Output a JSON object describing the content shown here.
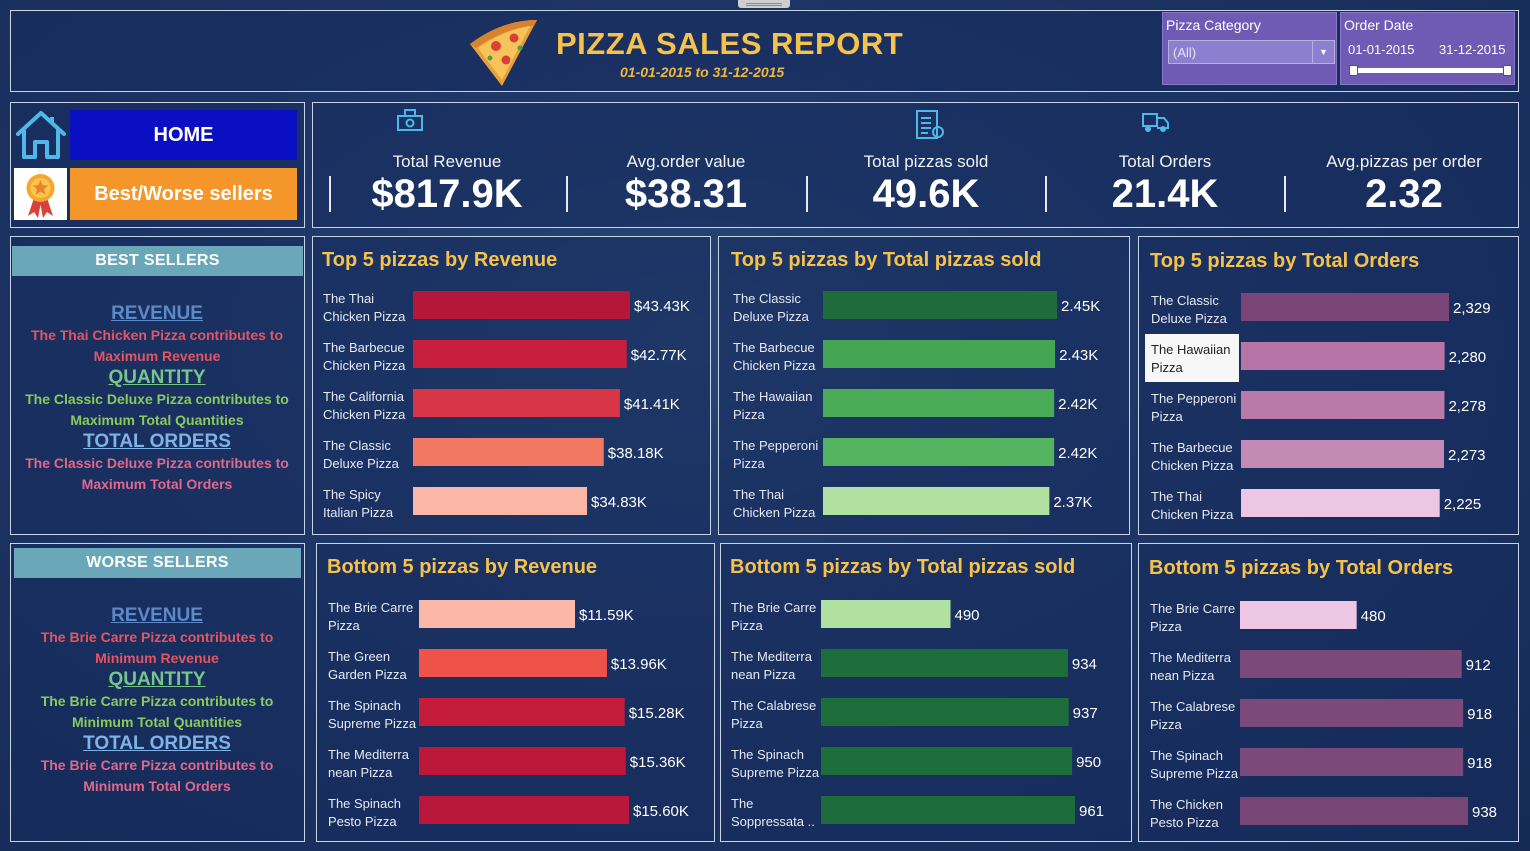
{
  "header": {
    "title": "PIZZA SALES REPORT",
    "subtitle": "01-01-2015 to 31-12-2015",
    "filters": {
      "category_label": "Pizza Category",
      "category_value": "(All)",
      "date_label": "Order Date",
      "date_start": "01-01-2015",
      "date_end": "31-12-2015"
    }
  },
  "nav": {
    "home": "HOME",
    "best_worse": "Best/Worse sellers"
  },
  "kpis": [
    {
      "label": "Total Revenue",
      "value": "$817.9K",
      "icon": "money-icon"
    },
    {
      "label": "Avg.order value",
      "value": "$38.31",
      "icon": ""
    },
    {
      "label": "Total pizzas sold",
      "value": "49.6K",
      "icon": "checklist-icon"
    },
    {
      "label": "Total Orders",
      "value": "21.4K",
      "icon": "delivery-icon"
    },
    {
      "label": "Avg.pizzas per order",
      "value": "2.32",
      "icon": ""
    }
  ],
  "best": {
    "title": "BEST SELLERS",
    "rev_head": "REVENUE",
    "rev_l1": "The Thai Chicken Pizza contributes to",
    "rev_l2": "Maximum Revenue",
    "qty_head": "QUANTITY",
    "qty_l1": "The Classic Deluxe Pizza contributes to",
    "qty_l2": "Maximum Total Quantities",
    "ord_head": "TOTAL ORDERS",
    "ord_l1": "The Classic Deluxe Pizza contributes to",
    "ord_l2": "Maximum Total Orders"
  },
  "worse": {
    "title": "WORSE SELLERS",
    "rev_head": "REVENUE",
    "rev_l1": "The Brie Carre Pizza contributes to",
    "rev_l2": "Minimum Revenue",
    "qty_head": "QUANTITY",
    "qty_l1": "The Brie Carre Pizza contributes to",
    "qty_l2": "Minimum Total Quantities",
    "ord_head": "TOTAL ORDERS",
    "ord_l1": "The Brie Carre Pizza  contributes to",
    "ord_l2": "Minimum Total Orders"
  },
  "chart_data": [
    {
      "id": "top-revenue",
      "type": "bar",
      "orientation": "horizontal",
      "title": "Top 5 pizzas by Revenue",
      "categories": [
        [
          "The Thai",
          "Chicken Pizza"
        ],
        [
          "The Barbecue",
          "Chicken Pizza"
        ],
        [
          "The California",
          "Chicken Pizza"
        ],
        [
          "The Classic",
          "Deluxe Pizza"
        ],
        [
          "The Spicy",
          "Italian Pizza"
        ]
      ],
      "values": [
        43430,
        42770,
        41410,
        38180,
        34830
      ],
      "labels": [
        "$43.43K",
        "$42.77K",
        "$41.41K",
        "$38.18K",
        "$34.83K"
      ],
      "colors": [
        "#b5173a",
        "#c91f3e",
        "#d93548",
        "#f27864",
        "#fbb7a5"
      ]
    },
    {
      "id": "top-qty",
      "type": "bar",
      "orientation": "horizontal",
      "title": "Top 5 pizzas by Total pizzas sold",
      "categories": [
        [
          "The Classic",
          "Deluxe Pizza"
        ],
        [
          "The Barbecue",
          "Chicken Pizza"
        ],
        [
          "The Hawaiian",
          "Pizza"
        ],
        [
          "The Pepperoni",
          "Pizza"
        ],
        [
          "The Thai",
          "Chicken Pizza"
        ]
      ],
      "values": [
        2450,
        2430,
        2420,
        2420,
        2370
      ],
      "labels": [
        "2.45K",
        "2.43K",
        "2.42K",
        "2.42K",
        "2.37K"
      ],
      "colors": [
        "#1f6b3a",
        "#44a653",
        "#4aab57",
        "#54b35e",
        "#b2e0a0"
      ]
    },
    {
      "id": "top-orders",
      "type": "bar",
      "orientation": "horizontal",
      "title": "Top 5 pizzas by Total Orders",
      "categories": [
        [
          "The Classic",
          "Deluxe Pizza"
        ],
        [
          "The Hawaiian",
          "Pizza"
        ],
        [
          "The Pepperoni",
          "Pizza"
        ],
        [
          "The Barbecue",
          "Chicken Pizza"
        ],
        [
          "The Thai",
          "Chicken Pizza"
        ]
      ],
      "values": [
        2329,
        2280,
        2278,
        2273,
        2225
      ],
      "labels": [
        "2,329",
        "2,280",
        "2,278",
        "2,273",
        "2,225"
      ],
      "colors": [
        "#7a4677",
        "#b774a6",
        "#b97aa9",
        "#c48ab6",
        "#ecc6e2"
      ],
      "highlight": 1
    },
    {
      "id": "bottom-revenue",
      "type": "bar",
      "orientation": "horizontal",
      "title": "Bottom  5 pizzas by Revenue",
      "categories": [
        [
          "The Brie Carre",
          "Pizza"
        ],
        [
          "The Green",
          "Garden Pizza"
        ],
        [
          "The Spinach",
          "Supreme Pizza"
        ],
        [
          "The Mediterra",
          "nean Pizza"
        ],
        [
          "The Spinach",
          "Pesto Pizza"
        ]
      ],
      "values": [
        11590,
        13960,
        15280,
        15360,
        15600
      ],
      "labels": [
        "$11.59K",
        "$13.96K",
        "$15.28K",
        "$15.36K",
        "$15.60K"
      ],
      "colors": [
        "#fbb8a8",
        "#ee5248",
        "#c61c3c",
        "#bd173a",
        "#b8163a"
      ]
    },
    {
      "id": "bottom-qty",
      "type": "bar",
      "orientation": "horizontal",
      "title": "Bottom 5 pizzas by Total pizzas sold",
      "categories": [
        [
          "The Brie Carre",
          "Pizza"
        ],
        [
          "The Mediterra",
          "nean Pizza"
        ],
        [
          "The Calabrese",
          "Pizza"
        ],
        [
          "The Spinach",
          "Supreme Pizza"
        ],
        [
          "The",
          "Soppressata .."
        ]
      ],
      "values": [
        490,
        934,
        937,
        950,
        961
      ],
      "labels": [
        "490",
        "934",
        "937",
        "950",
        "961"
      ],
      "colors": [
        "#b2e0a0",
        "#1e6e3c",
        "#1e6e3c",
        "#1e6e3c",
        "#1d6a3a"
      ]
    },
    {
      "id": "bottom-orders",
      "type": "bar",
      "orientation": "horizontal",
      "title": "Bottom 5 pizzas by Total Orders",
      "categories": [
        [
          "The Brie Carre",
          "Pizza"
        ],
        [
          "The Mediterra",
          "nean Pizza"
        ],
        [
          "The Calabrese",
          "Pizza"
        ],
        [
          "The Spinach",
          "Supreme Pizza"
        ],
        [
          "The Chicken",
          "Pesto Pizza"
        ]
      ],
      "values": [
        480,
        912,
        918,
        918,
        938
      ],
      "labels": [
        "480",
        "912",
        "918",
        "918",
        "938"
      ],
      "colors": [
        "#ecc6e2",
        "#7b4a7a",
        "#7b4a7a",
        "#7b4a7a",
        "#774676"
      ]
    }
  ]
}
